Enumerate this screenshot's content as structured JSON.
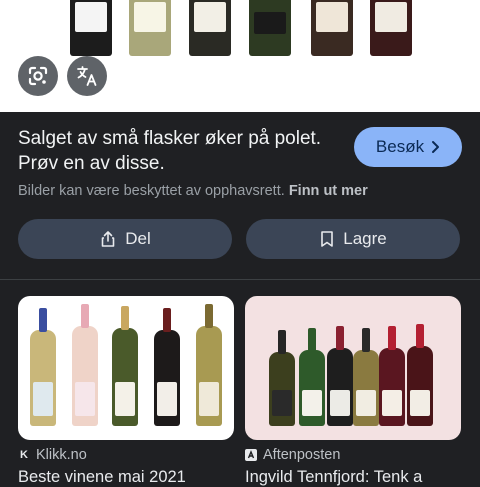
{
  "hero": {
    "lens_icon": "google-lens-icon",
    "translate_icon": "translate-icon"
  },
  "info": {
    "title": "Salget av små flasker øker på polet. Prøv en av disse.",
    "visit_label": "Besøk",
    "visit_icon": "chevron-right-icon",
    "copyright_text": "Bilder kan være beskyttet av opphavsrett.",
    "learn_more": "Finn ut mer"
  },
  "actions": {
    "share_label": "Del",
    "share_icon": "share-icon",
    "save_label": "Lagre",
    "save_icon": "bookmark-icon"
  },
  "related": [
    {
      "source": "Klikk.no",
      "source_icon": "klikk-logo-icon",
      "caption": "Beste vinene mai 2021"
    },
    {
      "source": "Aftenposten",
      "source_icon": "aftenposten-logo-icon",
      "caption": "Ingvild Tennfjord: Tenk a"
    }
  ],
  "colors": {
    "background": "#1f2023",
    "accent_button": "#8ab4f8",
    "action_button": "#3b4556"
  }
}
